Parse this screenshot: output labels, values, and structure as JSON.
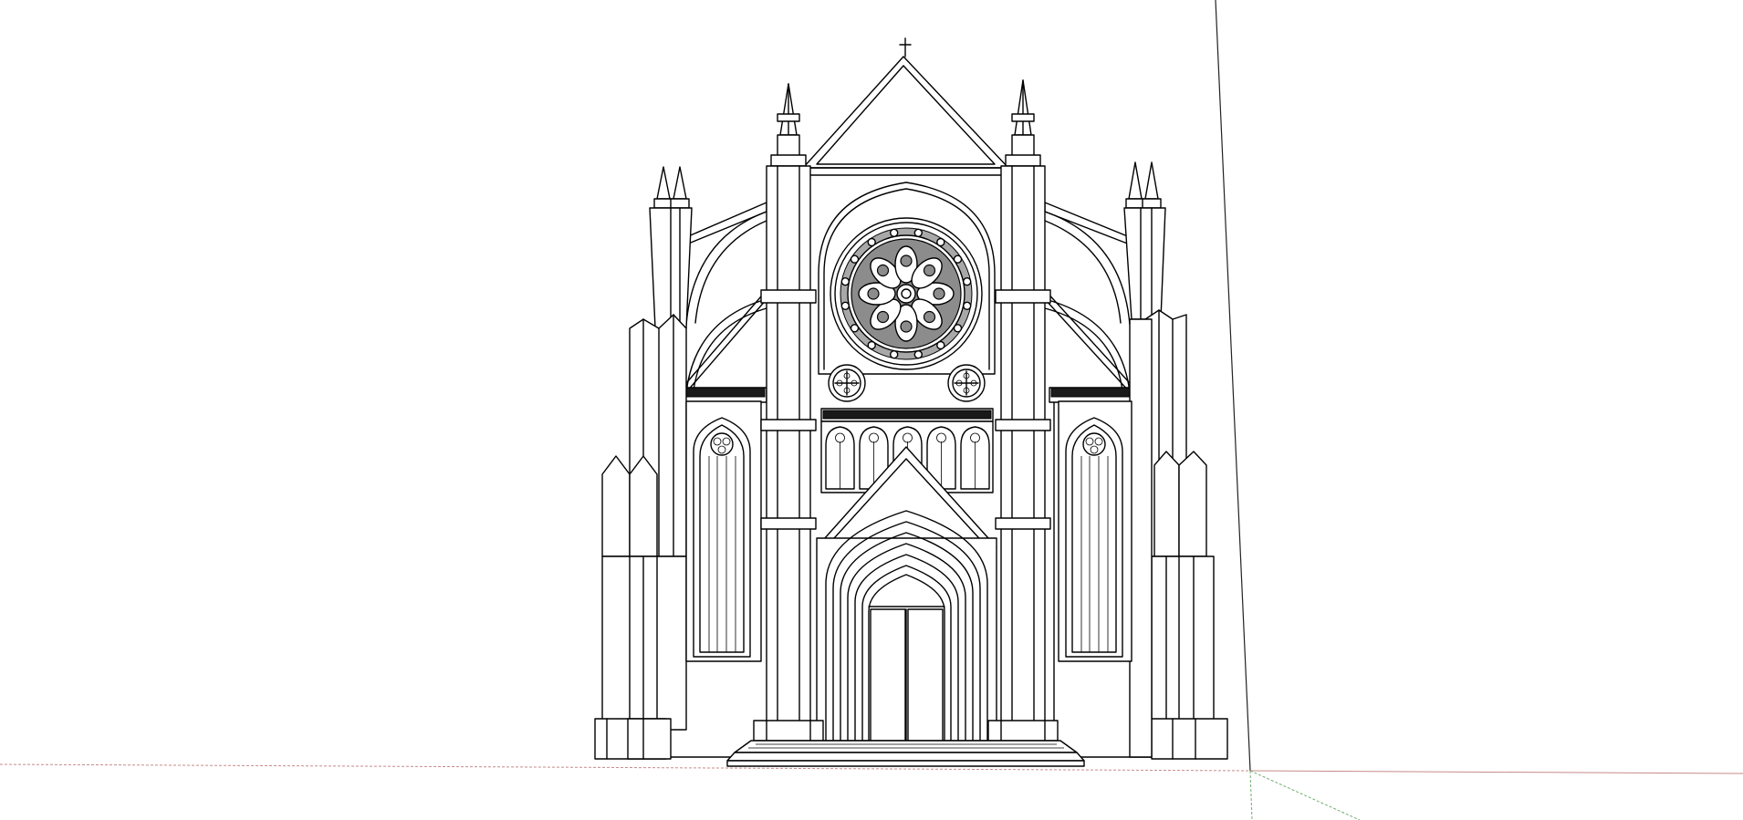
{
  "scene": {
    "background": "#ffffff",
    "line_color": "#000000",
    "glass_color": "#8c8c8c",
    "axes": {
      "red_axis_color": "#c88a8a",
      "green_axis_color": "#6fae6f",
      "blue_axis_color": "#222222"
    },
    "model": "gothic-cathedral-facade"
  }
}
